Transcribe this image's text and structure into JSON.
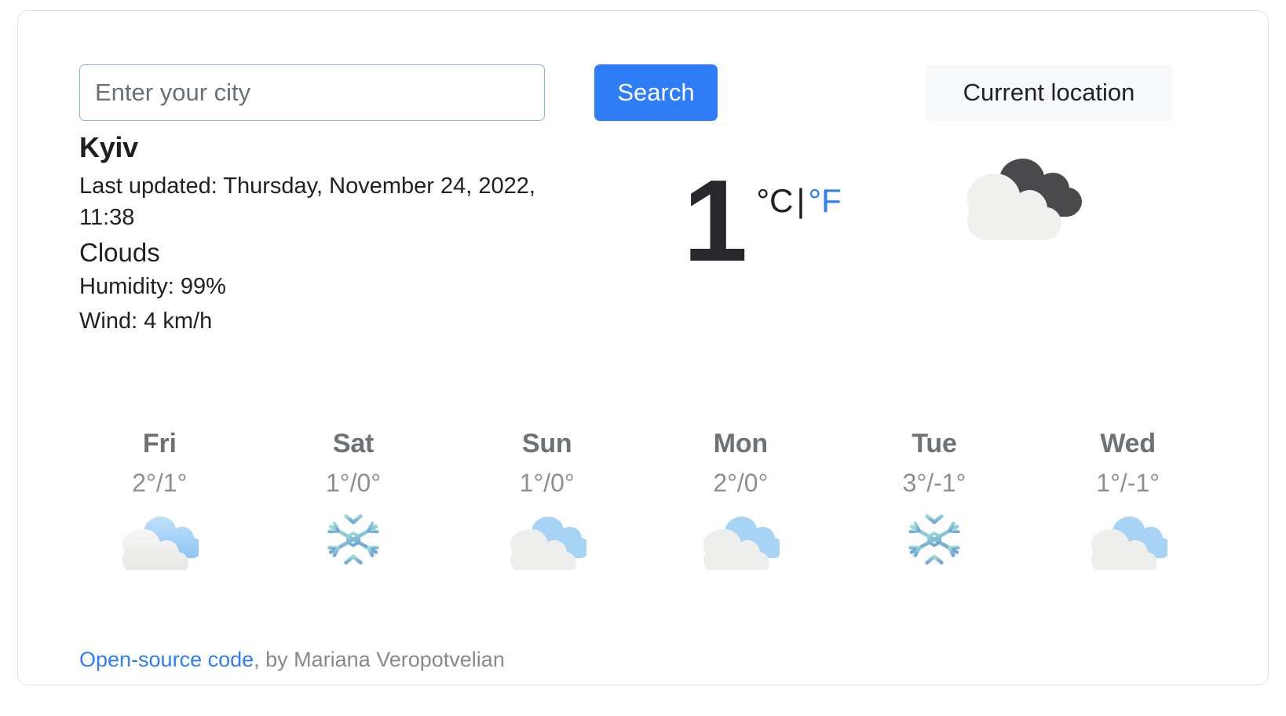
{
  "search": {
    "placeholder": "Enter your city",
    "value": "",
    "search_label": "Search",
    "current_location_label": "Current location"
  },
  "current": {
    "city": "Kyiv",
    "last_updated": "Last updated: Thursday, November 24, 2022, 11:38",
    "condition": "Clouds",
    "humidity": "Humidity: 99%",
    "wind": "Wind: 4 km/h",
    "temperature": "1",
    "unit_celsius": "°C",
    "unit_separator": "|",
    "unit_fahrenheit": "°F",
    "icon": "clouds-icon"
  },
  "forecast": [
    {
      "day": "Fri",
      "temps": "2°/1°",
      "icon": "broken-clouds-icon"
    },
    {
      "day": "Sat",
      "temps": "1°/0°",
      "icon": "snowflake-icon"
    },
    {
      "day": "Sun",
      "temps": "1°/0°",
      "icon": "broken-clouds-icon"
    },
    {
      "day": "Mon",
      "temps": "2°/0°",
      "icon": "broken-clouds-icon"
    },
    {
      "day": "Tue",
      "temps": "3°/-1°",
      "icon": "snowflake-icon"
    },
    {
      "day": "Wed",
      "temps": "1°/-1°",
      "icon": "broken-clouds-icon"
    }
  ],
  "footer": {
    "link_label": "Open-source code",
    "credit": ", by Mariana Veropotvelian"
  },
  "colors": {
    "accent_blue": "#2e7cf6",
    "card_border": "#dfe1e5",
    "button_gray": "#f7f8f9",
    "muted_text": "#8b8f94"
  }
}
